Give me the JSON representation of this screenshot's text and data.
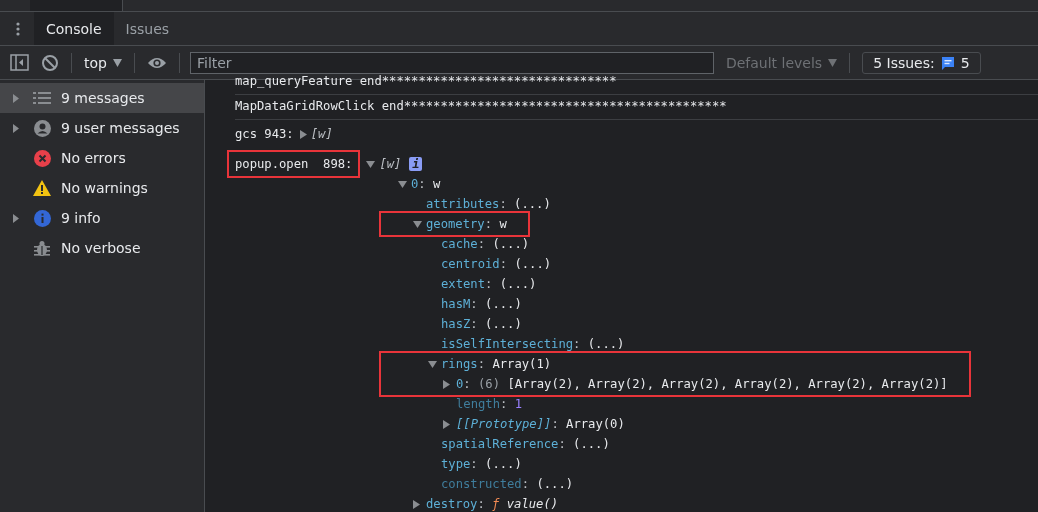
{
  "tabs": [
    {
      "label": "Console",
      "selected": true
    },
    {
      "label": "Issues",
      "selected": false
    }
  ],
  "toolbar": {
    "context": "top",
    "filter": {
      "placeholder": "Filter"
    },
    "levels": "Default levels",
    "issues": {
      "label": "5 Issues:",
      "count": "5"
    }
  },
  "sidebar": {
    "items": [
      {
        "kind": "messages",
        "label": "9 messages",
        "expandable": true,
        "selected": true
      },
      {
        "kind": "user",
        "label": "9 user messages",
        "expandable": true,
        "selected": false
      },
      {
        "kind": "errors",
        "label": "No errors",
        "expandable": false,
        "selected": false
      },
      {
        "kind": "warnings",
        "label": "No warnings",
        "expandable": false,
        "selected": false
      },
      {
        "kind": "info",
        "label": "9 info",
        "expandable": true,
        "selected": false
      },
      {
        "kind": "verbose",
        "label": "No verbose",
        "expandable": false,
        "selected": false
      }
    ]
  },
  "console": {
    "entries": [
      {
        "kind": "text",
        "text": "map_queryFeature end********************************"
      },
      {
        "kind": "text",
        "text": "MapDataGridRowClick end********************************************"
      },
      {
        "kind": "object",
        "prefix": "gcs 943:",
        "prefix_highlighted": false,
        "expanded": false,
        "preview": "[w]"
      },
      {
        "kind": "object",
        "prefix": "popup.open  898:",
        "prefix_highlighted": true,
        "expanded": true,
        "preview": "[w]",
        "badge": "i",
        "children": [
          {
            "kind": "property",
            "key": "0",
            "sep": ":",
            "value": "w",
            "expandable": true,
            "expanded": true,
            "highlighted": false,
            "children": [
              {
                "kind": "property",
                "key": "attributes",
                "sep": ":",
                "value": "(...)",
                "expandable": false,
                "expanded": false,
                "highlighted": false
              },
              {
                "kind": "property",
                "key": "geometry",
                "sep": ":",
                "value": "w",
                "expandable": true,
                "expanded": true,
                "highlighted": true,
                "children": [
                  {
                    "kind": "property",
                    "key": "cache",
                    "sep": ":",
                    "value": "(...)",
                    "expandable": false,
                    "expanded": false,
                    "highlighted": false
                  },
                  {
                    "kind": "property",
                    "key": "centroid",
                    "sep": ":",
                    "value": "(...)",
                    "expandable": false,
                    "expanded": false,
                    "highlighted": false
                  },
                  {
                    "kind": "property",
                    "key": "extent",
                    "sep": ":",
                    "value": "(...)",
                    "expandable": false,
                    "expanded": false,
                    "highlighted": false
                  },
                  {
                    "kind": "property",
                    "key": "hasM",
                    "sep": ":",
                    "value": "(...)",
                    "expandable": false,
                    "expanded": false,
                    "highlighted": false
                  },
                  {
                    "kind": "property",
                    "key": "hasZ",
                    "sep": ":",
                    "value": "(...)",
                    "expandable": false,
                    "expanded": false,
                    "highlighted": false
                  },
                  {
                    "kind": "property",
                    "key": "isSelfIntersecting",
                    "sep": ":",
                    "value": "(...)",
                    "expandable": false,
                    "expanded": false,
                    "highlighted": false
                  },
                  {
                    "kind": "property",
                    "key": "rings",
                    "sep": ":",
                    "value": "Array(1)",
                    "expandable": true,
                    "expanded": true,
                    "highlighted": true,
                    "children": [
                      {
                        "kind": "property",
                        "key": "0",
                        "sep": ":",
                        "count": "(6)",
                        "value": "[Array(2), Array(2), Array(2), Array(2), Array(2), Array(2)]",
                        "expandable": true,
                        "expanded": false,
                        "highlighted": true
                      },
                      {
                        "kind": "number",
                        "key": "length",
                        "sep": ":",
                        "value": "1",
                        "expandable": false,
                        "expanded": false,
                        "highlighted": false
                      },
                      {
                        "kind": "internal",
                        "key": "[[Prototype]]",
                        "sep": ":",
                        "value": "Array(0)",
                        "expandable": true,
                        "expanded": false,
                        "highlighted": false
                      }
                    ]
                  },
                  {
                    "kind": "property",
                    "key": "spatialReference",
                    "sep": ":",
                    "value": "(...)",
                    "expandable": false,
                    "expanded": false,
                    "highlighted": false
                  },
                  {
                    "kind": "property",
                    "key": "type",
                    "sep": ":",
                    "value": "(...)",
                    "expandable": false,
                    "expanded": false,
                    "highlighted": false
                  },
                  {
                    "kind": "meta",
                    "key": "constructed",
                    "sep": ":",
                    "value": "(...)",
                    "expandable": false,
                    "expanded": false,
                    "highlighted": false
                  }
                ]
              },
              {
                "kind": "method",
                "key": "destroy",
                "sep": ":",
                "sign": "ƒ",
                "value": "value()",
                "expandable": true,
                "expanded": false,
                "highlighted": false
              }
            ]
          }
        ]
      }
    ]
  }
}
